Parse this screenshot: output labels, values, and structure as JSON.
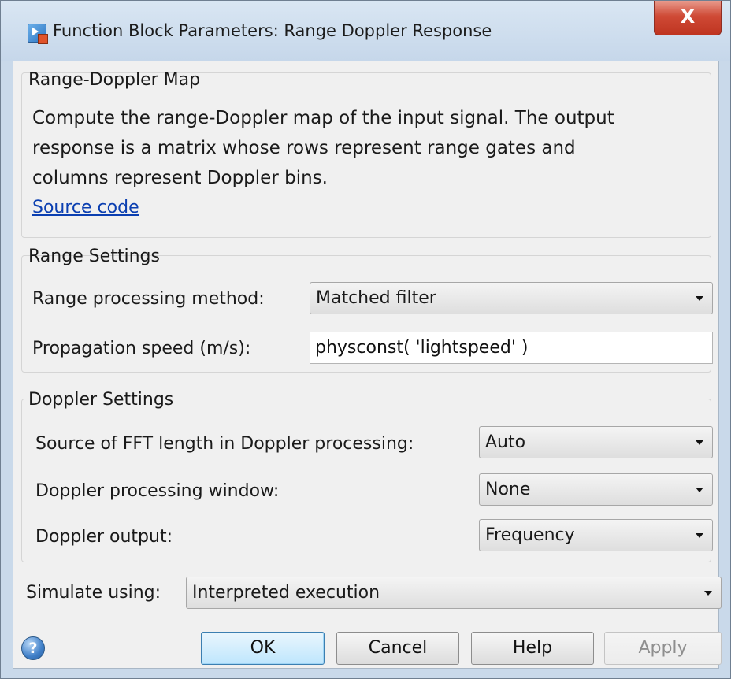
{
  "window": {
    "title": "Function Block Parameters: Range Doppler Response",
    "close_glyph": "X"
  },
  "range_doppler_map": {
    "title": "Range-Doppler Map",
    "description_lines": [
      "Compute the range-Doppler map of the input signal. The output",
      "response is a matrix whose rows represent range gates and",
      "columns represent Doppler bins."
    ],
    "link": "Source code"
  },
  "range_settings": {
    "title": "Range Settings",
    "method_label": "Range processing method:",
    "method_value": "Matched filter",
    "speed_label": "Propagation speed (m/s):",
    "speed_value": "physconst( 'lightspeed' )"
  },
  "doppler_settings": {
    "title": "Doppler Settings",
    "fft_label": "Source of FFT length in Doppler processing:",
    "fft_value": "Auto",
    "window_label": "Doppler processing window:",
    "window_value": "None",
    "output_label": "Doppler output:",
    "output_value": "Frequency"
  },
  "simulate": {
    "label": "Simulate using:",
    "value": "Interpreted execution"
  },
  "buttons": {
    "ok": "OK",
    "cancel": "Cancel",
    "help": "Help",
    "apply": "Apply"
  },
  "help_icon": {
    "glyph": "?"
  }
}
